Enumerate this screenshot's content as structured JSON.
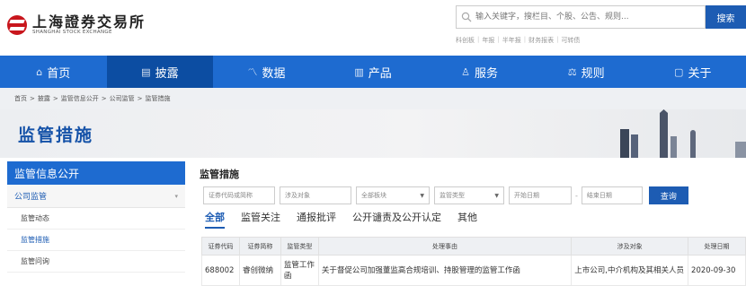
{
  "header": {
    "logo_cn": "上海證券交易所",
    "logo_en": "SHANGHAI STOCK EXCHANGE",
    "search_placeholder": "输入关键字，搜栏目、个股、公告、规则...",
    "search_button": "搜索",
    "quick_links": [
      "科创板",
      "年报",
      "半年报",
      "财务报表",
      "可转债"
    ]
  },
  "nav": [
    {
      "label": "首页",
      "icon": "home-icon",
      "glyph": "⌂"
    },
    {
      "label": "披露",
      "icon": "document-icon",
      "glyph": "▤"
    },
    {
      "label": "数据",
      "icon": "chart-line-icon",
      "glyph": "〽"
    },
    {
      "label": "产品",
      "icon": "bar-chart-icon",
      "glyph": "▥"
    },
    {
      "label": "服务",
      "icon": "user-icon",
      "glyph": "♙"
    },
    {
      "label": "规则",
      "icon": "scale-icon",
      "glyph": "⚖"
    },
    {
      "label": "关于",
      "icon": "info-icon",
      "glyph": "▢"
    }
  ],
  "breadcrumb": [
    "首页",
    "披露",
    "监管信息公开",
    "公司监管",
    "监管措施"
  ],
  "page_title": "监管措施",
  "sidebar": {
    "heading": "监管信息公开",
    "section": "公司监管",
    "items": [
      "监管动态",
      "监管措施",
      "监管问询"
    ]
  },
  "content": {
    "title": "监管措施",
    "filters": {
      "code_placeholder": "证券代码或简称",
      "target_placeholder": "涉及对象",
      "board": "全部板块",
      "type": "监管类型",
      "start_date": "开始日期",
      "end_date": "结束日期",
      "query_button": "查询"
    },
    "tabs": [
      "全部",
      "监管关注",
      "通报批评",
      "公开谴责及公开认定",
      "其他"
    ],
    "table": {
      "headers": [
        "证券代码",
        "证券简称",
        "监管类型",
        "处理事由",
        "涉及对象",
        "处理日期"
      ],
      "rows": [
        [
          "688002",
          "睿创微纳",
          "监管工作函",
          "关于督促公司加强董监高合规培训、持股管理的监管工作函",
          "上市公司,中介机构及其相关人员",
          "2020-09-30"
        ]
      ]
    }
  },
  "colors": {
    "brand_blue": "#1e6bd0",
    "nav_active": "#0c4da2",
    "logo_red": "#c8161d"
  }
}
